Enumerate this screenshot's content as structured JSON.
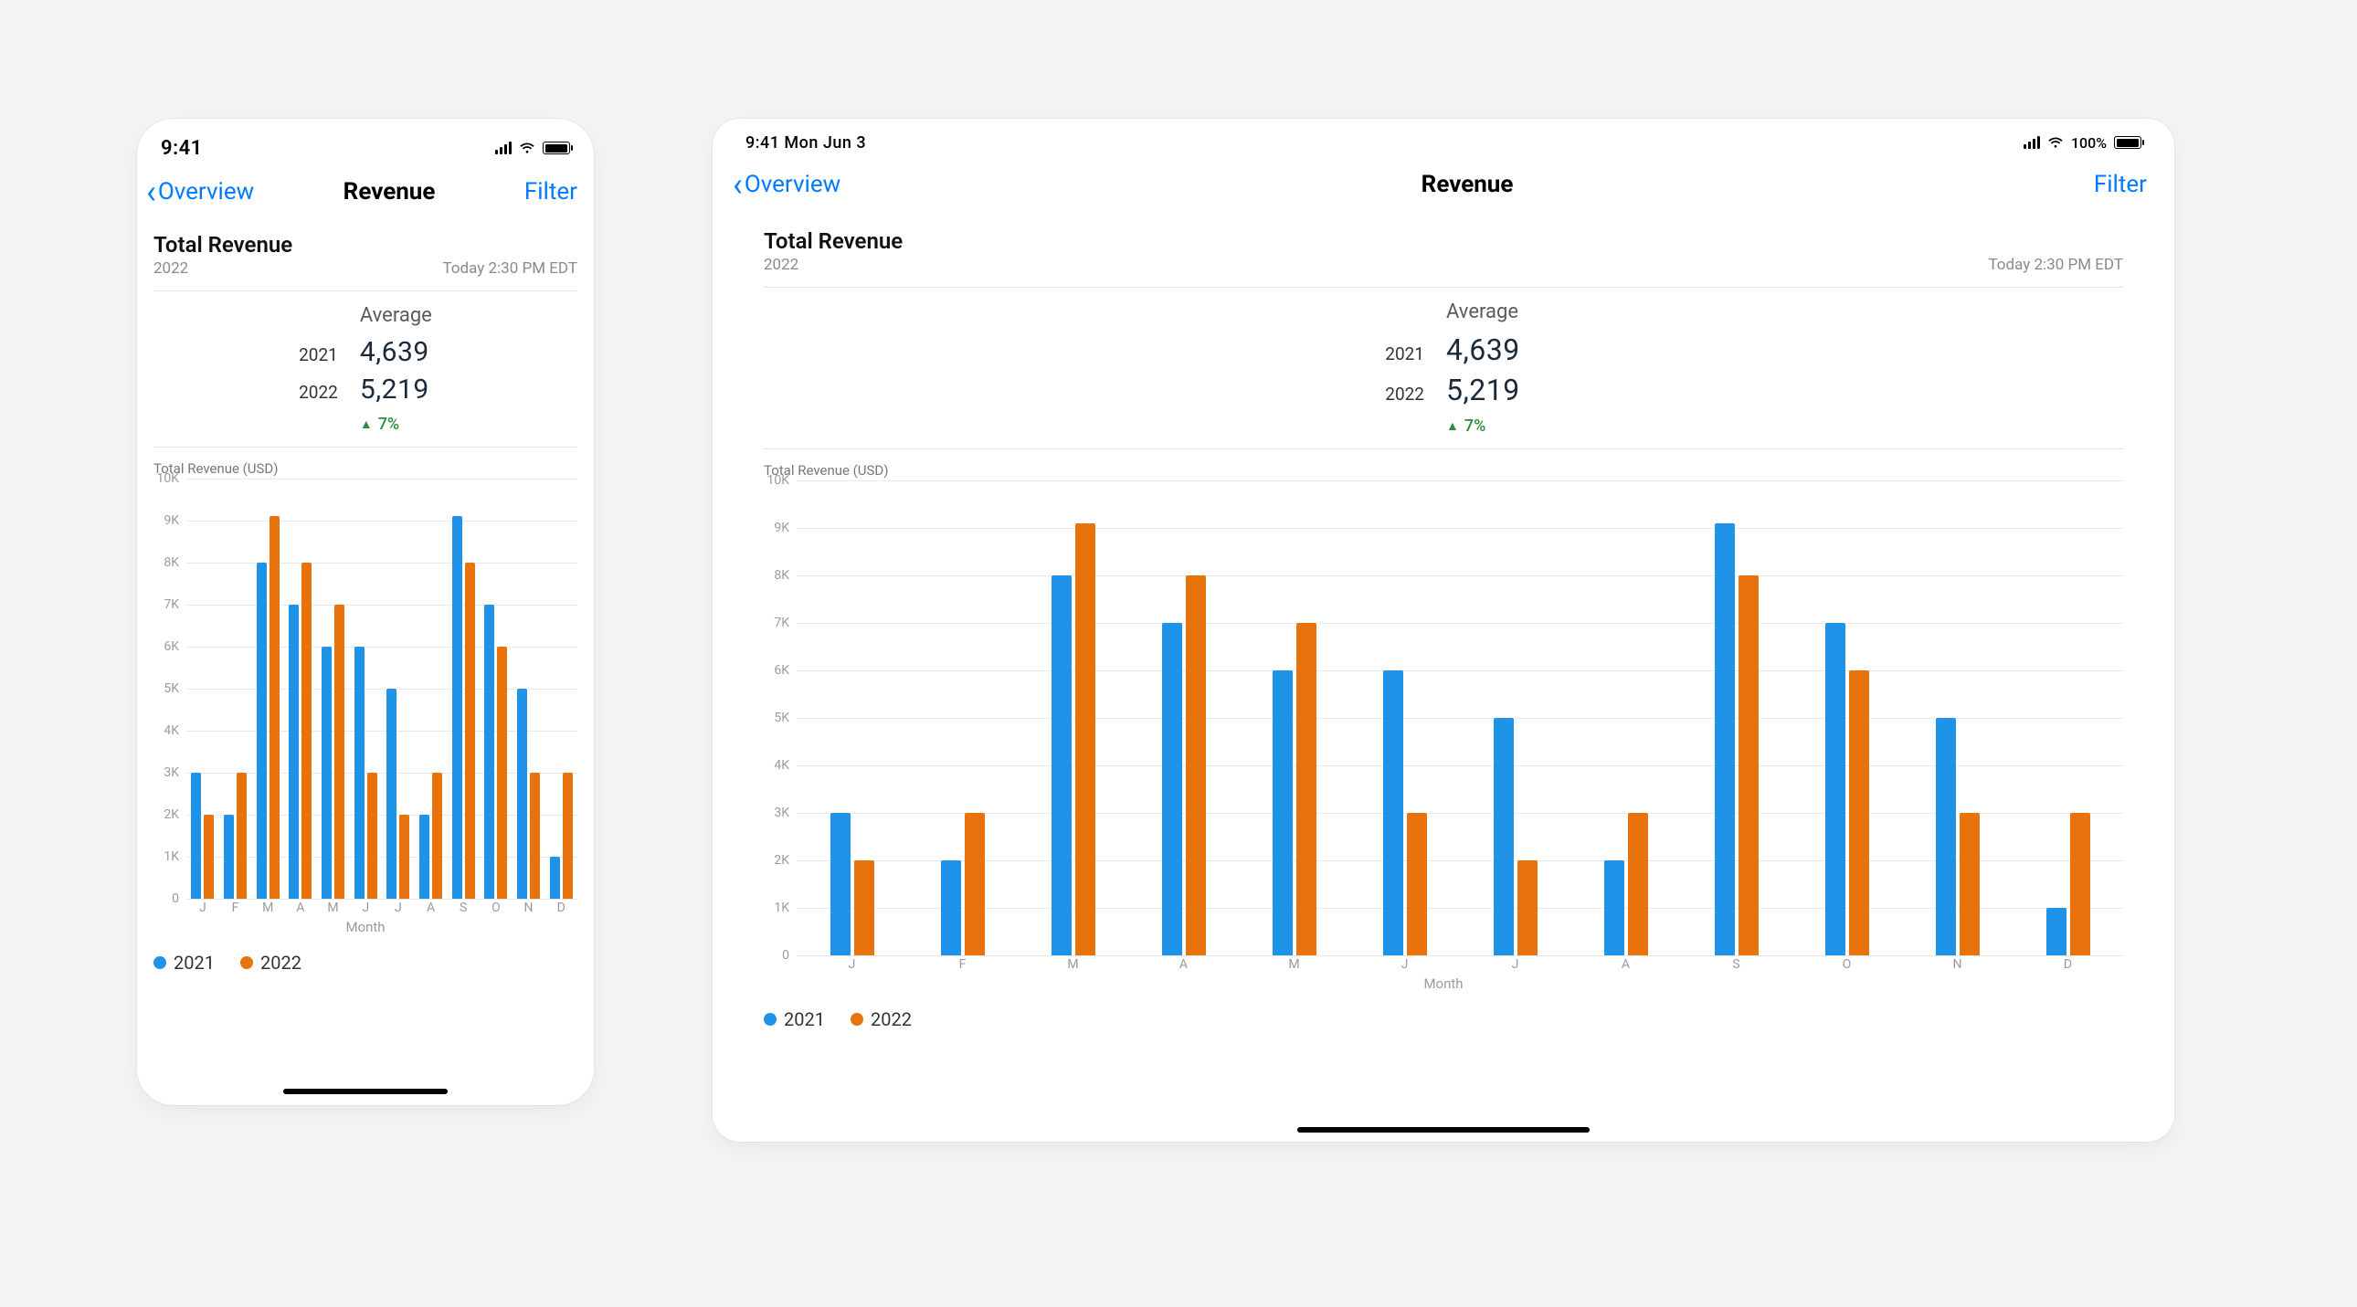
{
  "colors": {
    "series_a": "#1f93e8",
    "series_b": "#e8720c",
    "link": "#007aff",
    "delta": "#2e8b3d"
  },
  "statusbar": {
    "phone_time": "9:41",
    "tablet_time": "9:41 Mon Jun 3",
    "battery_pct_label": "100%"
  },
  "nav": {
    "back_label": "Overview",
    "title": "Revenue",
    "filter_label": "Filter"
  },
  "header": {
    "title": "Total Revenue",
    "subyear": "2022",
    "timestamp": "Today 2:30 PM EDT"
  },
  "averages": {
    "heading": "Average",
    "rows": [
      {
        "year": "2021",
        "value": "4,639"
      },
      {
        "year": "2022",
        "value": "5,219"
      }
    ],
    "delta_label": "7%"
  },
  "legend": {
    "a": "2021",
    "b": "2022"
  },
  "chart_label": "Total Revenue (USD)",
  "xaxis_title": "Month",
  "chart_data": {
    "type": "bar",
    "title": "Total Revenue (USD)",
    "xlabel": "Month",
    "ylabel": "",
    "ylim": [
      0,
      10000
    ],
    "yticks": [
      0,
      1000,
      2000,
      3000,
      4000,
      5000,
      6000,
      7000,
      8000,
      9000,
      10000
    ],
    "ytick_labels": [
      "0",
      "1K",
      "2K",
      "3K",
      "4K",
      "5K",
      "6K",
      "7K",
      "8K",
      "9K",
      "10K"
    ],
    "categories": [
      "J",
      "F",
      "M",
      "A",
      "M",
      "J",
      "J",
      "A",
      "S",
      "O",
      "N",
      "D"
    ],
    "series": [
      {
        "name": "2021",
        "values": [
          3000,
          2000,
          8000,
          7000,
          6000,
          6000,
          5000,
          2000,
          9100,
          7000,
          5000,
          1000
        ]
      },
      {
        "name": "2022",
        "values": [
          2000,
          3000,
          9100,
          8000,
          7000,
          3000,
          2000,
          3000,
          8000,
          6000,
          3000,
          3000
        ]
      }
    ]
  }
}
